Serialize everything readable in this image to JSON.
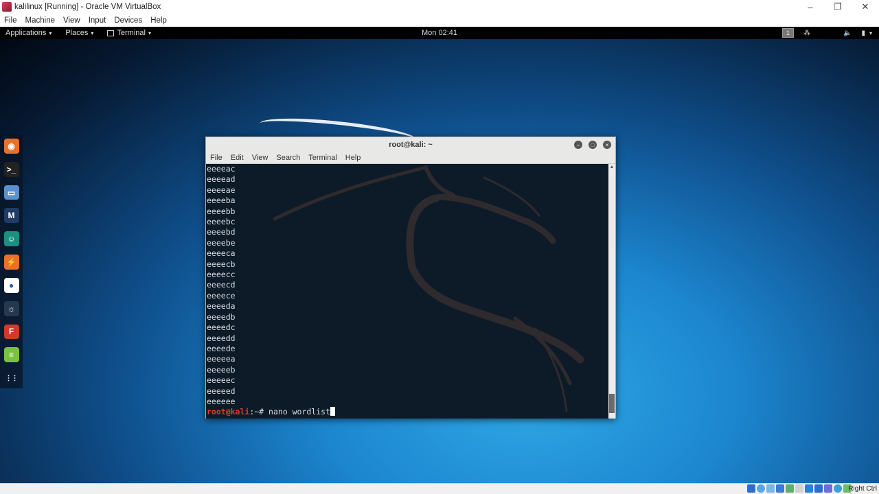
{
  "vbox": {
    "title": "kalilinux [Running] - Oracle VM VirtualBox",
    "window_controls": {
      "minimize": "–",
      "restore": "❐",
      "close": "✕"
    },
    "menu": [
      "File",
      "Machine",
      "View",
      "Input",
      "Devices",
      "Help"
    ],
    "host_key": "Right Ctrl"
  },
  "gnome": {
    "applications": "Applications",
    "places": "Places",
    "terminal": "Terminal",
    "caret": "▾",
    "clock": "Mon 02:41",
    "workspace": "1",
    "tray_icons": [
      "network-icon",
      "volume-icon",
      "battery-icon",
      "system-menu-icon"
    ]
  },
  "dock": {
    "items": [
      {
        "name": "firefox",
        "glyph": "◉",
        "color": "#e8712b"
      },
      {
        "name": "terminal",
        "glyph": ">_",
        "color": "#222222"
      },
      {
        "name": "files",
        "glyph": "▭",
        "color": "#5b8fd0"
      },
      {
        "name": "metasploit",
        "glyph": "M",
        "color": "#1f3c66"
      },
      {
        "name": "armitage",
        "glyph": "☺",
        "color": "#1c8f80"
      },
      {
        "name": "burpsuite",
        "glyph": "⚡",
        "color": "#e8712b"
      },
      {
        "name": "maltego",
        "glyph": "●",
        "color": "#ffffff"
      },
      {
        "name": "beef",
        "glyph": "☼",
        "color": "#24384f"
      },
      {
        "name": "faraday",
        "glyph": "F",
        "color": "#d23a2c"
      },
      {
        "name": "leafpad",
        "glyph": "≡",
        "color": "#7cc242"
      },
      {
        "name": "show-apps",
        "glyph": "⋮⋮",
        "color": "transparent"
      }
    ]
  },
  "terminal": {
    "title": "root@kali: ~",
    "menu": [
      "File",
      "Edit",
      "View",
      "Search",
      "Terminal",
      "Help"
    ],
    "output": [
      "eeeeac",
      "eeeead",
      "eeeeae",
      "eeeeba",
      "eeeebb",
      "eeeebc",
      "eeeebd",
      "eeeebe",
      "eeeeca",
      "eeeecb",
      "eeeecc",
      "eeeecd",
      "eeeece",
      "eeeeda",
      "eeeedb",
      "eeeedc",
      "eeeedd",
      "eeeede",
      "eeeeea",
      "eeeeeb",
      "eeeeec",
      "eeeeed",
      "eeeeee"
    ],
    "prompt_user": "root@kali",
    "prompt_rest": ":~# ",
    "command": "nano wordlist"
  }
}
